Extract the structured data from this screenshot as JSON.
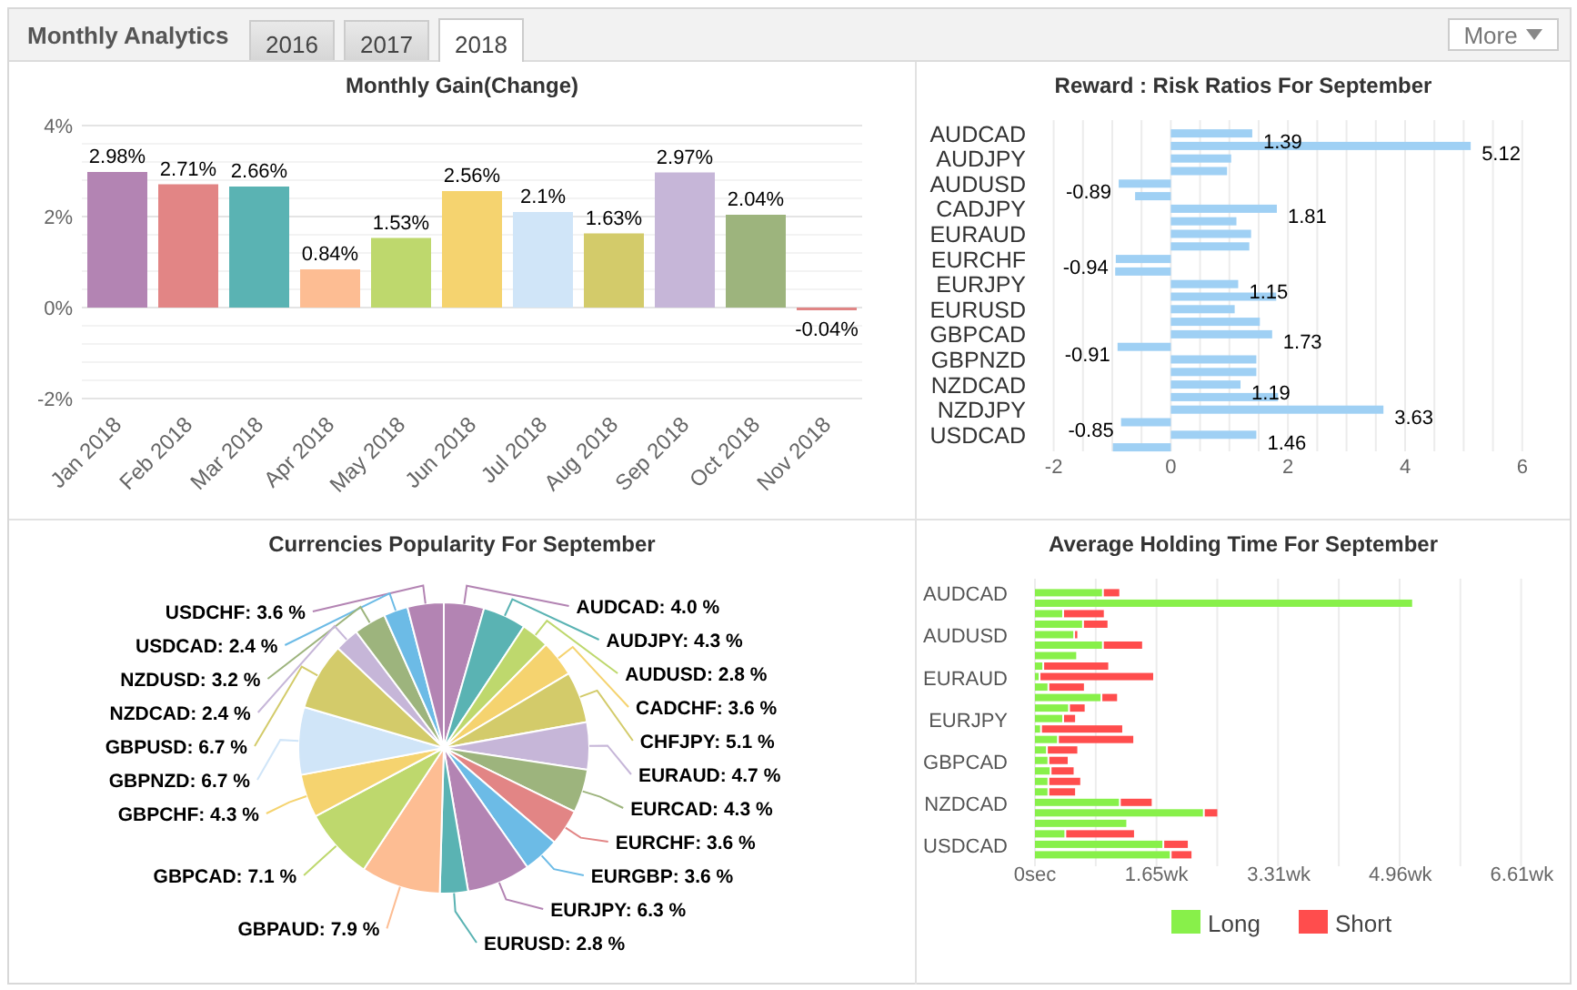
{
  "header": {
    "title": "Monthly Analytics"
  },
  "tabs": [
    {
      "label": "2016",
      "selected": false
    },
    {
      "label": "2017",
      "selected": false
    },
    {
      "label": "2018",
      "selected": true
    }
  ],
  "more_button": {
    "label": "More"
  },
  "panels": [
    {
      "chart_data": {
        "type": "bar",
        "title": "Monthly Gain(Change)",
        "categories": [
          "Jan 2018",
          "Feb 2018",
          "Mar 2018",
          "Apr 2018",
          "May 2018",
          "Jun 2018",
          "Jul 2018",
          "Aug 2018",
          "Sep 2018",
          "Oct 2018",
          "Nov 2018"
        ],
        "series": [
          {
            "values": [
              2.98,
              2.71,
              2.66,
              0.84,
              1.53,
              2.56,
              2.1,
              1.63,
              2.97,
              2.04,
              -0.04
            ]
          }
        ],
        "colors": [
          "#b384b3",
          "#e28585",
          "#5ab3b3",
          "#fdbd93",
          "#bed86d",
          "#f5d36f",
          "#d0e5f8",
          "#d3cb6a",
          "#c6b6d8",
          "#9db47d",
          "#e08585"
        ],
        "value_labels": [
          "2.98%",
          "2.71%",
          "2.66%",
          "0.84%",
          "1.53%",
          "2.56%",
          "2.1%",
          "1.63%",
          "2.97%",
          "2.04%",
          "-0.04%"
        ],
        "ylim": [
          -2,
          4
        ],
        "yticks": [
          {
            "value": 4,
            "label": "4%"
          },
          {
            "value": 2,
            "label": "2%"
          },
          {
            "value": 0,
            "label": "0%"
          },
          {
            "value": -2,
            "label": "-2%"
          }
        ]
      }
    },
    {
      "chart_data": {
        "type": "bar",
        "orientation": "horizontal",
        "title": "Reward : Risk Ratios For September",
        "grid": true,
        "categories": [
          "AUDCAD",
          null,
          "AUDJPY",
          null,
          "AUDUSD",
          null,
          "CADJPY",
          null,
          "EURAUD",
          null,
          "EURCHF",
          null,
          "EURJPY",
          null,
          "EURUSD",
          null,
          "GBPCAD",
          null,
          "GBPNZD",
          null,
          "NZDCAD",
          null,
          "NZDJPY",
          null,
          "USDCAD",
          null
        ],
        "series": [
          {
            "color": "#9fd0f4",
            "values": [
              1.39,
              5.12,
              1.03,
              0.96,
              -0.89,
              -0.61,
              1.81,
              1.12,
              1.37,
              1.34,
              -0.94,
              -0.95,
              1.15,
              1.8,
              1.09,
              1.52,
              1.73,
              -0.91,
              1.46,
              1.46,
              1.19,
              1.83,
              3.63,
              -0.85,
              1.46,
              -0.99
            ]
          }
        ],
        "xlim": [
          -2,
          6
        ],
        "xticks": [
          -2,
          0,
          2,
          4,
          6
        ],
        "value_labels": [
          "1.39",
          "5.12",
          null,
          null,
          "-0.89",
          null,
          "1.81",
          null,
          null,
          null,
          "-0.94",
          null,
          "1.15",
          null,
          null,
          null,
          "1.73",
          "-0.91",
          null,
          null,
          "1.19",
          null,
          "3.63",
          "-0.85",
          "1.46",
          null
        ]
      }
    },
    {
      "chart_data": {
        "type": "pie",
        "title": "Currencies Popularity For September",
        "values": [
          4.0,
          4.3,
          2.8,
          3.6,
          5.1,
          4.7,
          4.3,
          3.6,
          3.6,
          6.3,
          2.8,
          7.9,
          7.1,
          4.3,
          6.7,
          6.7,
          2.4,
          3.2,
          2.4,
          3.6
        ],
        "colors": [
          "#b384b3",
          "#5ab3b3",
          "#bed86d",
          "#f5d36f",
          "#d3cb6a",
          "#c6b6d8",
          "#9db47d",
          "#e28585",
          "#6cbbe6",
          "#b384b3",
          "#5ab3b3",
          "#fdbd93",
          "#bed86d",
          "#f5d36f",
          "#d0e5f8",
          "#d3cb6a",
          "#c6b6d8",
          "#9db47d",
          "#6cbbe6",
          "#b384b3"
        ],
        "value_labels": [
          "AUDCAD: 4.0 %",
          "AUDJPY: 4.3 %",
          "AUDUSD: 2.8 %",
          "CADCHF: 3.6 %",
          "CHFJPY: 5.1 %",
          "EURAUD: 4.7 %",
          "EURCAD: 4.3 %",
          "EURCHF: 3.6 %",
          "EURGBP: 3.6 %",
          "EURJPY: 6.3 %",
          "EURUSD: 2.8 %",
          "GBPAUD: 7.9 %",
          "GBPCAD: 7.1 %",
          "GBPCHF: 4.3 %",
          "GBPNZD: 6.7 %",
          "GBPUSD: 6.7 %",
          "NZDCAD: 2.4 %",
          "NZDUSD: 3.2 %",
          "USDCAD: 2.4 %",
          "USDCHF: 3.6 %"
        ]
      }
    },
    {
      "chart_data": {
        "type": "bar",
        "orientation": "horizontal",
        "stacked": true,
        "title": "Average Holding Time For September",
        "grid": true,
        "legend": "bottom",
        "categories": [
          "AUDCAD",
          null,
          null,
          null,
          "AUDUSD",
          null,
          null,
          null,
          "EURAUD",
          null,
          null,
          null,
          "EURJPY",
          null,
          null,
          null,
          "GBPCAD",
          null,
          null,
          null,
          "NZDCAD",
          null,
          null,
          null,
          "USDCAD",
          null
        ],
        "series": [
          {
            "name": "Long",
            "color": "#88f04a",
            "values": [
              0.91,
              5.12,
              0.37,
              0.64,
              0.52,
              0.91,
              0.56,
              0.1,
              0.05,
              0.17,
              0.89,
              0.45,
              0.37,
              0.07,
              0.3,
              0.15,
              0.17,
              0.2,
              0.17,
              0.17,
              1.14,
              2.28,
              1.24,
              0.4,
              1.73,
              1.83
            ]
          },
          {
            "name": "Short",
            "color": "#ff4d4d",
            "values": [
              0.21,
              0,
              0.54,
              0.32,
              0.03,
              0.52,
              0,
              0.87,
              1.53,
              0.47,
              0.2,
              0.2,
              0.15,
              1.09,
              1.01,
              0.4,
              0.25,
              0.3,
              0.42,
              0.35,
              0.42,
              0.17,
              0,
              0.92,
              0.32,
              0.27
            ]
          }
        ],
        "xlim": [
          0,
          6.61
        ],
        "xticks": [
          {
            "value": 0,
            "label": "0sec"
          },
          {
            "value": 1.65,
            "label": "1.65wk"
          },
          {
            "value": 3.31,
            "label": "3.31wk"
          },
          {
            "value": 4.96,
            "label": "4.96wk"
          },
          {
            "value": 6.61,
            "label": "6.61wk"
          }
        ]
      }
    }
  ]
}
